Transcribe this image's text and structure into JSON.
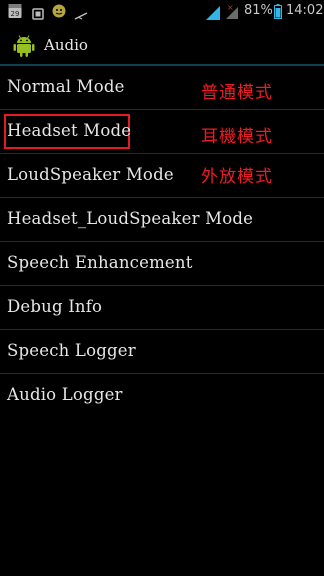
{
  "status_bar": {
    "battery_percent": "81%",
    "time": "14:02",
    "notification_date": "29",
    "icons": [
      "calendar-icon",
      "screenshot-icon",
      "usb-debug-icon",
      "usb-icon",
      "signal-icon",
      "signal-no-data-icon",
      "battery-icon"
    ]
  },
  "action_bar": {
    "title": "Audio",
    "icon": "android-robot-icon"
  },
  "accent_color": "#ee1c24",
  "list": {
    "items": [
      {
        "label": "Normal Mode",
        "annotation": "普通模式"
      },
      {
        "label": "Headset Mode",
        "annotation": "耳機模式"
      },
      {
        "label": "LoudSpeaker Mode",
        "annotation": "外放模式"
      },
      {
        "label": "Headset_LoudSpeaker Mode"
      },
      {
        "label": "Speech Enhancement"
      },
      {
        "label": "Debug Info"
      },
      {
        "label": "Speech Logger"
      },
      {
        "label": "Audio Logger"
      }
    ]
  }
}
